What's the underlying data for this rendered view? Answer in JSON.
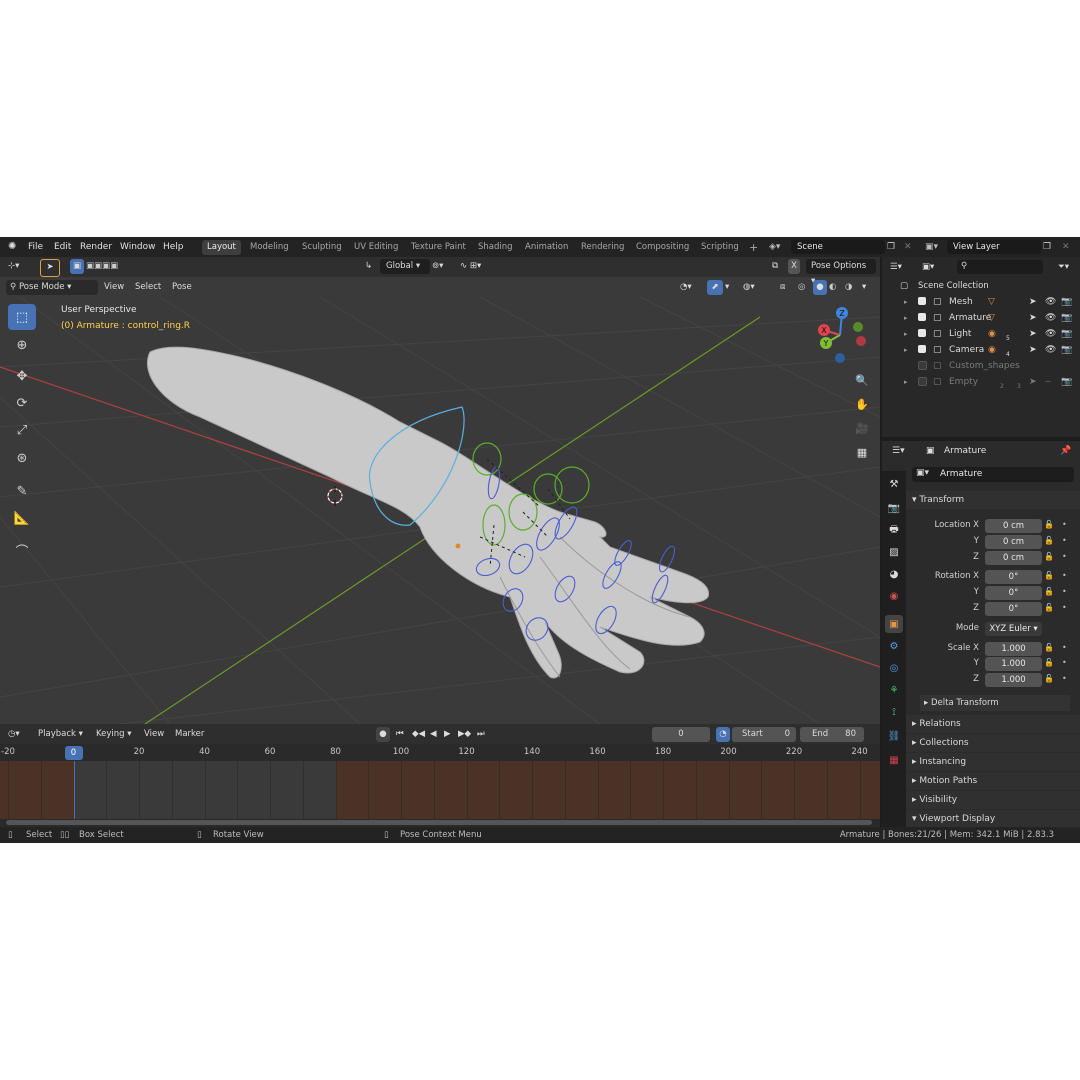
{
  "topbar": {
    "menus": [
      "File",
      "Edit",
      "Render",
      "Window",
      "Help"
    ],
    "workspaces": [
      "Layout",
      "Modeling",
      "Sculpting",
      "UV Editing",
      "Texture Paint",
      "Shading",
      "Animation",
      "Rendering",
      "Compositing",
      "Scripting"
    ],
    "active_workspace": "Layout",
    "add_tab": "+",
    "scene": "Scene",
    "view_layer": "View Layer"
  },
  "viewport": {
    "orientation": "Global",
    "mode": "Pose Mode",
    "header_menus": [
      "View",
      "Select",
      "Pose"
    ],
    "pose_options": "Pose Options",
    "x_toggle": "X",
    "perspective_label": "User Perspective",
    "object_label": "(0) Armature : control_ring.R",
    "gizmo": {
      "x": "X",
      "y": "Y",
      "z": "Z"
    }
  },
  "outliner": {
    "root": "Scene Collection",
    "items": [
      {
        "name": "Mesh",
        "enabled": true
      },
      {
        "name": "Armature",
        "enabled": true
      },
      {
        "name": "Light",
        "enabled": true,
        "badge": "5"
      },
      {
        "name": "Camera",
        "enabled": true,
        "badge": "4"
      },
      {
        "name": "Custom_shapes",
        "enabled": false
      },
      {
        "name": "Empty",
        "enabled": false,
        "badge": "2",
        "badge2": "3"
      }
    ]
  },
  "properties": {
    "header_object": "Armature",
    "object_name": "Armature",
    "transform_title": "Transform",
    "location": {
      "label_x": "Location X",
      "x": "0 cm",
      "y": "0 cm",
      "z": "0 cm"
    },
    "rotation": {
      "label_x": "Rotation X",
      "x": "0°",
      "y": "0°",
      "z": "0°"
    },
    "mode_label": "Mode",
    "mode_value": "XYZ Euler",
    "scale": {
      "label_x": "Scale X",
      "x": "1.000",
      "y": "1.000",
      "z": "1.000"
    },
    "axis_y": "Y",
    "axis_z": "Z",
    "delta_transform": "Delta Transform",
    "sections": [
      "Relations",
      "Collections",
      "Instancing",
      "Motion Paths",
      "Visibility",
      "Viewport Display"
    ]
  },
  "timeline": {
    "menus": [
      "Playback",
      "Keying",
      "View",
      "Marker"
    ],
    "current_frame": "0",
    "start_label": "Start",
    "start": "0",
    "end_label": "End",
    "end": "80",
    "ruler": [
      "-20",
      "0",
      "20",
      "40",
      "60",
      "80",
      "100",
      "120",
      "140",
      "160",
      "180",
      "200",
      "220",
      "240"
    ],
    "frame_start": 0,
    "frame_end": 80
  },
  "statusbar": {
    "select": "Select",
    "box_select": "Box Select",
    "rotate_view": "Rotate View",
    "pose_context_menu": "Pose Context Menu",
    "info": "Armature | Bones:21/26 | Mem: 342.1 MiB | 2.83.3"
  },
  "colors": {
    "accent": "#4772b3",
    "active_bone": "#ffd24a",
    "axis_x": "#e0444f",
    "axis_y": "#7fbd36",
    "axis_z": "#3f86e0",
    "timeline_range": "#3a3a3a",
    "timeline_outside": "#4a3326"
  }
}
